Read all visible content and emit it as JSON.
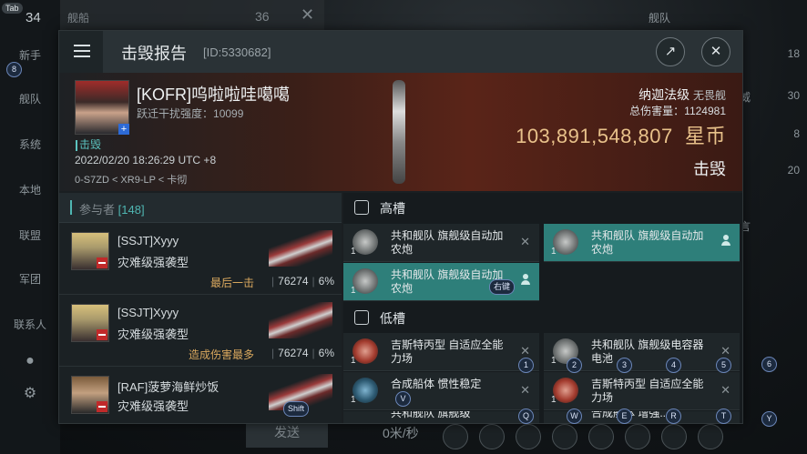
{
  "background": {
    "tab_key": "Tab",
    "top_count": "34",
    "top_tab_label": "舰船",
    "top_tab_count": "36",
    "fleet_label": "舰队",
    "left_nav": [
      "新手",
      "舰队",
      "系统",
      "本地",
      "联盟",
      "军团",
      "联系人"
    ],
    "right_values": [
      "18",
      "30",
      "8",
      "20",
      "威",
      "言"
    ],
    "send_label": "发送",
    "speed_label": "0米/秒"
  },
  "report": {
    "title": "击毁报告",
    "id": "[ID:5330682]",
    "victim": {
      "name": "[KOFR]呜啦啦哇噶噶",
      "jam_label": "跃迁干扰强度：",
      "jam_value": "10099",
      "kill_tag": "击毁",
      "datetime": "2022/02/20 18:26:29 UTC +8",
      "location": "0-S7ZD < XR9-LP < 卡彻"
    },
    "ship": {
      "name": "纳迦法级",
      "class": "无畏舰",
      "total_damage_label": "总伤害量：",
      "total_damage": "1124981",
      "isk_value": "103,891,548,807",
      "isk_unit": "星币",
      "status": "击毁"
    },
    "participants": {
      "header": "参与者",
      "count": "[148]",
      "rows": [
        {
          "name": "[SSJT]Xyyy",
          "ship": "灾难级强袭型",
          "tag": "最后一击",
          "damage": "76274",
          "percent": "6%"
        },
        {
          "name": "[SSJT]Xyyy",
          "ship": "灾难级强袭型",
          "tag": "造成伤害最多",
          "damage": "76274",
          "percent": "6%"
        },
        {
          "name": "[RAF]菠萝海鲜炒饭",
          "ship": "灾难级强袭型",
          "tag": "",
          "damage": "",
          "percent": ""
        }
      ]
    },
    "slots": {
      "high_label": "高槽",
      "low_label": "低槽",
      "high": [
        {
          "qty": "1",
          "label": "共和舰队 旗舰级自动加农炮"
        },
        {
          "qty": "1",
          "label": "共和舰队 旗舰级自动加农炮"
        },
        {
          "qty": "1",
          "label": "共和舰队 旗舰级自动加农炮"
        }
      ],
      "low": [
        {
          "qty": "1",
          "label": "吉斯特丙型 自适应全能力场"
        },
        {
          "qty": "1",
          "label": "共和舰队 旗舰级电容器电池"
        },
        {
          "qty": "1",
          "label": "合成船体 惯性稳定"
        },
        {
          "qty": "1",
          "label": "吉斯特丙型 自适应全能力场"
        },
        {
          "qty": "1",
          "label": "共和舰队 旗舰级"
        },
        {
          "qty": "1",
          "label": "合成船体 增强..."
        }
      ]
    }
  },
  "hotkeys": {
    "k8": "8",
    "shift": "Shift",
    "right_click": "右键",
    "k1": "1",
    "k2": "2",
    "k3": "3",
    "k4": "4",
    "k5": "5",
    "k6": "6",
    "kQ": "Q",
    "kW": "W",
    "kE": "E",
    "kR": "R",
    "kT": "T",
    "kY": "Y",
    "kV": "V"
  }
}
